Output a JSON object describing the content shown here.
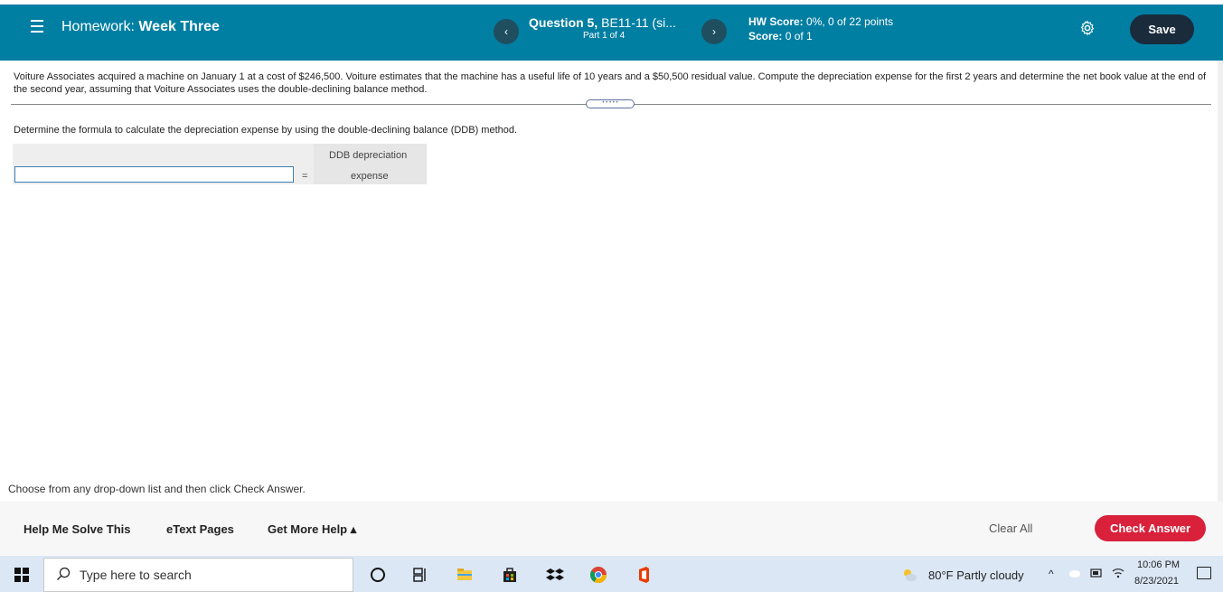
{
  "header": {
    "title_prefix": "Homework:",
    "title_name": "Week Three",
    "question_label": "Question 5,",
    "question_sub": "BE11-11 (si...",
    "part": "Part 1 of 4",
    "hw_score_label": "HW Score:",
    "hw_score_value": "0%, 0 of 22 points",
    "score_label": "Score:",
    "score_value": "0 of 1",
    "save_label": "Save",
    "prev_label": "‹",
    "next_label": "›"
  },
  "problem": {
    "text": "Voiture Associates acquired a machine on January 1 at a cost of $246,500. Voiture estimates that the machine has a useful life of 10 years and a $50,500 residual value. Compute the depreciation expense for the first 2 years and determine the net book value at the end of the second year, assuming that Voiture Associates uses the double-declining balance method.",
    "handle_dots": "• • • • •"
  },
  "question": {
    "instruction": "Determine the formula to calculate the depreciation expense by using the double-declining balance (DDB) method.",
    "equals": "=",
    "result_label_line1": "DDB depreciation",
    "result_label_line2": "expense"
  },
  "footer": {
    "note": "Choose from any drop-down list and then click Check Answer.",
    "help_me_solve": "Help Me Solve This",
    "etext": "eText Pages",
    "more_help": "Get More Help ▴",
    "clear_all": "Clear All",
    "check_answer": "Check Answer"
  },
  "taskbar": {
    "search_placeholder": "Type here to search",
    "weather": "80°F  Partly cloudy",
    "time": "10:06 PM",
    "date": "8/23/2021"
  },
  "colors": {
    "header": "#007FA3",
    "save": "#1a2b3c",
    "check": "#d9213b"
  }
}
